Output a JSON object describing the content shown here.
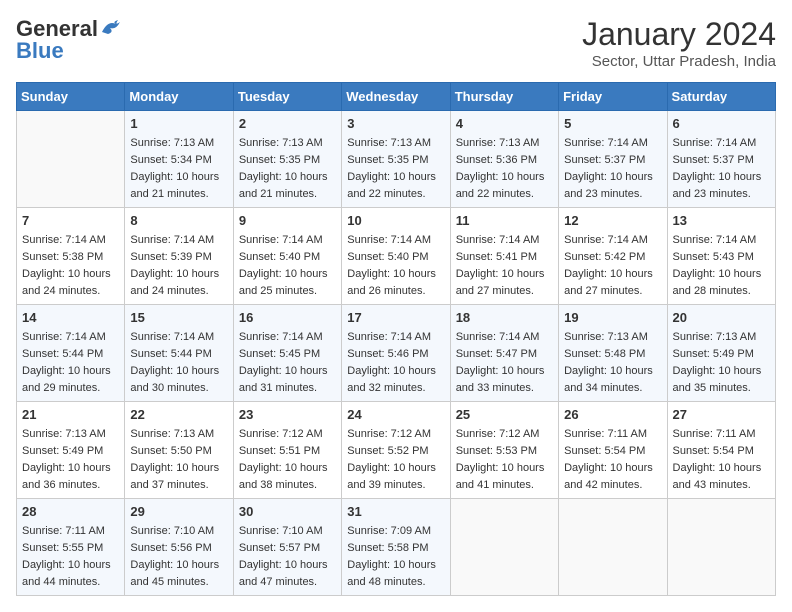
{
  "header": {
    "logo_general": "General",
    "logo_blue": "Blue",
    "title": "January 2024",
    "subtitle": "Sector, Uttar Pradesh, India"
  },
  "weekdays": [
    "Sunday",
    "Monday",
    "Tuesday",
    "Wednesday",
    "Thursday",
    "Friday",
    "Saturday"
  ],
  "weeks": [
    [
      {
        "day": "",
        "info": ""
      },
      {
        "day": "1",
        "info": "Sunrise: 7:13 AM\nSunset: 5:34 PM\nDaylight: 10 hours\nand 21 minutes."
      },
      {
        "day": "2",
        "info": "Sunrise: 7:13 AM\nSunset: 5:35 PM\nDaylight: 10 hours\nand 21 minutes."
      },
      {
        "day": "3",
        "info": "Sunrise: 7:13 AM\nSunset: 5:35 PM\nDaylight: 10 hours\nand 22 minutes."
      },
      {
        "day": "4",
        "info": "Sunrise: 7:13 AM\nSunset: 5:36 PM\nDaylight: 10 hours\nand 22 minutes."
      },
      {
        "day": "5",
        "info": "Sunrise: 7:14 AM\nSunset: 5:37 PM\nDaylight: 10 hours\nand 23 minutes."
      },
      {
        "day": "6",
        "info": "Sunrise: 7:14 AM\nSunset: 5:37 PM\nDaylight: 10 hours\nand 23 minutes."
      }
    ],
    [
      {
        "day": "7",
        "info": "Sunrise: 7:14 AM\nSunset: 5:38 PM\nDaylight: 10 hours\nand 24 minutes."
      },
      {
        "day": "8",
        "info": "Sunrise: 7:14 AM\nSunset: 5:39 PM\nDaylight: 10 hours\nand 24 minutes."
      },
      {
        "day": "9",
        "info": "Sunrise: 7:14 AM\nSunset: 5:40 PM\nDaylight: 10 hours\nand 25 minutes."
      },
      {
        "day": "10",
        "info": "Sunrise: 7:14 AM\nSunset: 5:40 PM\nDaylight: 10 hours\nand 26 minutes."
      },
      {
        "day": "11",
        "info": "Sunrise: 7:14 AM\nSunset: 5:41 PM\nDaylight: 10 hours\nand 27 minutes."
      },
      {
        "day": "12",
        "info": "Sunrise: 7:14 AM\nSunset: 5:42 PM\nDaylight: 10 hours\nand 27 minutes."
      },
      {
        "day": "13",
        "info": "Sunrise: 7:14 AM\nSunset: 5:43 PM\nDaylight: 10 hours\nand 28 minutes."
      }
    ],
    [
      {
        "day": "14",
        "info": "Sunrise: 7:14 AM\nSunset: 5:44 PM\nDaylight: 10 hours\nand 29 minutes."
      },
      {
        "day": "15",
        "info": "Sunrise: 7:14 AM\nSunset: 5:44 PM\nDaylight: 10 hours\nand 30 minutes."
      },
      {
        "day": "16",
        "info": "Sunrise: 7:14 AM\nSunset: 5:45 PM\nDaylight: 10 hours\nand 31 minutes."
      },
      {
        "day": "17",
        "info": "Sunrise: 7:14 AM\nSunset: 5:46 PM\nDaylight: 10 hours\nand 32 minutes."
      },
      {
        "day": "18",
        "info": "Sunrise: 7:14 AM\nSunset: 5:47 PM\nDaylight: 10 hours\nand 33 minutes."
      },
      {
        "day": "19",
        "info": "Sunrise: 7:13 AM\nSunset: 5:48 PM\nDaylight: 10 hours\nand 34 minutes."
      },
      {
        "day": "20",
        "info": "Sunrise: 7:13 AM\nSunset: 5:49 PM\nDaylight: 10 hours\nand 35 minutes."
      }
    ],
    [
      {
        "day": "21",
        "info": "Sunrise: 7:13 AM\nSunset: 5:49 PM\nDaylight: 10 hours\nand 36 minutes."
      },
      {
        "day": "22",
        "info": "Sunrise: 7:13 AM\nSunset: 5:50 PM\nDaylight: 10 hours\nand 37 minutes."
      },
      {
        "day": "23",
        "info": "Sunrise: 7:12 AM\nSunset: 5:51 PM\nDaylight: 10 hours\nand 38 minutes."
      },
      {
        "day": "24",
        "info": "Sunrise: 7:12 AM\nSunset: 5:52 PM\nDaylight: 10 hours\nand 39 minutes."
      },
      {
        "day": "25",
        "info": "Sunrise: 7:12 AM\nSunset: 5:53 PM\nDaylight: 10 hours\nand 41 minutes."
      },
      {
        "day": "26",
        "info": "Sunrise: 7:11 AM\nSunset: 5:54 PM\nDaylight: 10 hours\nand 42 minutes."
      },
      {
        "day": "27",
        "info": "Sunrise: 7:11 AM\nSunset: 5:54 PM\nDaylight: 10 hours\nand 43 minutes."
      }
    ],
    [
      {
        "day": "28",
        "info": "Sunrise: 7:11 AM\nSunset: 5:55 PM\nDaylight: 10 hours\nand 44 minutes."
      },
      {
        "day": "29",
        "info": "Sunrise: 7:10 AM\nSunset: 5:56 PM\nDaylight: 10 hours\nand 45 minutes."
      },
      {
        "day": "30",
        "info": "Sunrise: 7:10 AM\nSunset: 5:57 PM\nDaylight: 10 hours\nand 47 minutes."
      },
      {
        "day": "31",
        "info": "Sunrise: 7:09 AM\nSunset: 5:58 PM\nDaylight: 10 hours\nand 48 minutes."
      },
      {
        "day": "",
        "info": ""
      },
      {
        "day": "",
        "info": ""
      },
      {
        "day": "",
        "info": ""
      }
    ]
  ]
}
